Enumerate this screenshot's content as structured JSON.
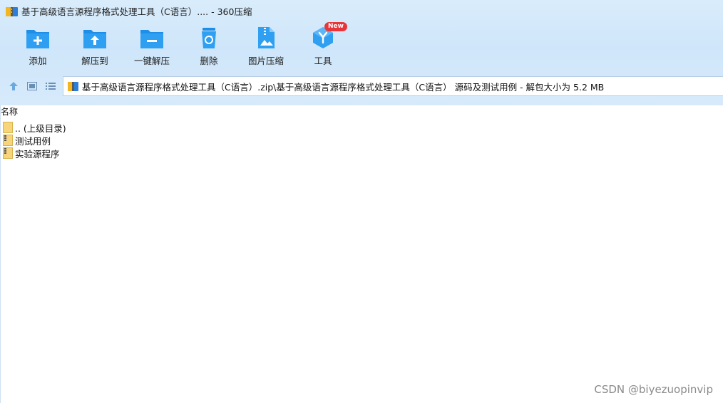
{
  "window": {
    "title": "基于高级语言源程序格式处理工具（C语言）.... - 360压缩"
  },
  "toolbar": {
    "items": [
      {
        "label": "添加",
        "icon": "add-folder-icon"
      },
      {
        "label": "解压到",
        "icon": "extract-to-folder-icon"
      },
      {
        "label": "一键解压",
        "icon": "one-click-extract-icon"
      },
      {
        "label": "删除",
        "icon": "recycle-bin-icon"
      },
      {
        "label": "图片压缩",
        "icon": "image-compress-icon"
      },
      {
        "label": "工具",
        "icon": "tools-cube-icon",
        "badge": "New"
      }
    ]
  },
  "nav": {
    "up_icon": "up-arrow-icon",
    "view_icon": "thumbnail-view-icon",
    "list_icon": "list-view-icon"
  },
  "address": {
    "path": "基于高级语言源程序格式处理工具（C语言）.zip\\基于高级语言源程序格式处理工具（C语言） 源码及测试用例 - 解包大小为 5.2 MB"
  },
  "file_list": {
    "column_name": "名称",
    "items": [
      {
        "name": ".. (上级目录)",
        "icon": "folder-icon"
      },
      {
        "name": "测试用例",
        "icon": "zip-folder-icon"
      },
      {
        "name": "实验源程序",
        "icon": "zip-folder-icon"
      }
    ]
  },
  "watermark": "CSDN @biyezuopinvip",
  "colors": {
    "chrome_background": "#d3e8fa",
    "icon_blue": "#1e8fe8",
    "badge_red": "#e8353a"
  }
}
